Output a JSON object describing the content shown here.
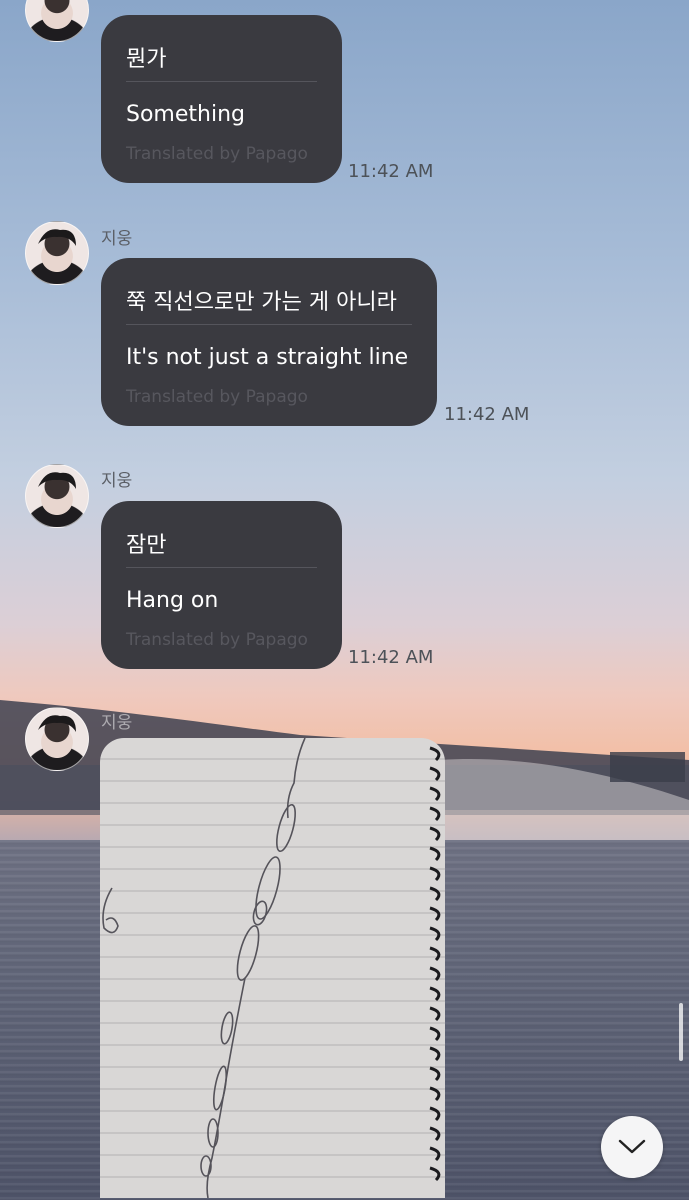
{
  "messages": [
    {
      "sender": "",
      "original": "뭔가",
      "translation": "Something",
      "credit": "Translated by Papago",
      "time": "11:42 AM"
    },
    {
      "sender": "지웅",
      "original": "쭉 직선으로만 가는 게 아니라",
      "translation": "It's not just a straight line",
      "credit": "Translated by Papago",
      "time": "11:42 AM"
    },
    {
      "sender": "지웅",
      "original": "잠만",
      "translation": "Hang on",
      "credit": "Translated by Papago",
      "time": "11:42 AM"
    },
    {
      "sender": "지웅",
      "attachment": "notebook-sketch-photo"
    }
  ],
  "icons": {
    "scroll_down": "chevron-down-icon"
  },
  "colors": {
    "bubble": "#3a3a40",
    "bubble_text": "#ffffff",
    "credit": "#57575e",
    "time": "#4d5258"
  }
}
